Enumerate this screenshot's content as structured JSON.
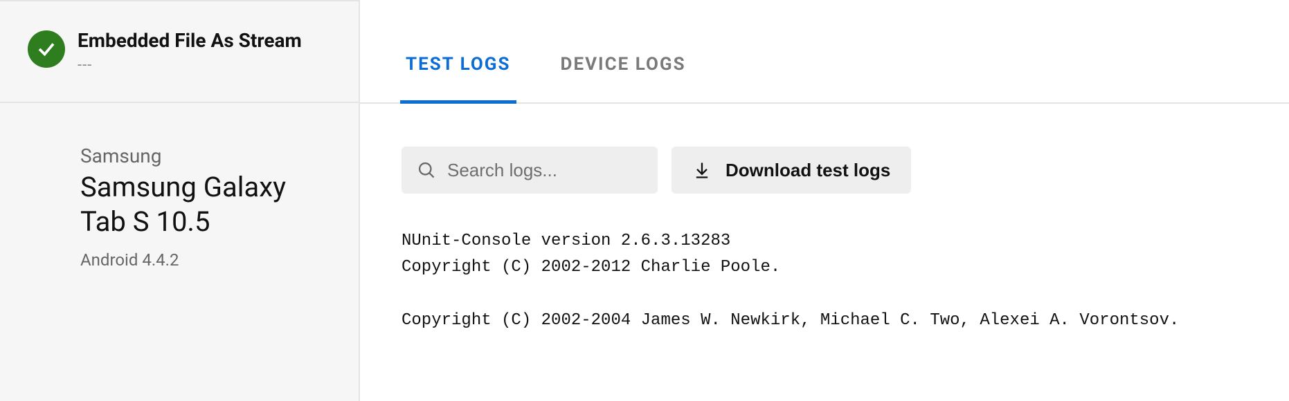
{
  "sidebar": {
    "test_title": "Embedded File As Stream",
    "test_subtitle": "---",
    "device": {
      "vendor": "Samsung",
      "name": "Samsung Galaxy Tab S 10.5",
      "os": "Android 4.4.2"
    }
  },
  "tabs": {
    "items": [
      {
        "label": "TEST LOGS",
        "active": true
      },
      {
        "label": "DEVICE LOGS",
        "active": false
      }
    ]
  },
  "controls": {
    "search_placeholder": "Search logs...",
    "download_label": "Download test logs"
  },
  "log_lines": [
    "NUnit-Console version 2.6.3.13283",
    "Copyright (C) 2002-2012 Charlie Poole.",
    "",
    "Copyright (C) 2002-2004 James W. Newkirk, Michael C. Two, Alexei A. Vorontsov."
  ]
}
